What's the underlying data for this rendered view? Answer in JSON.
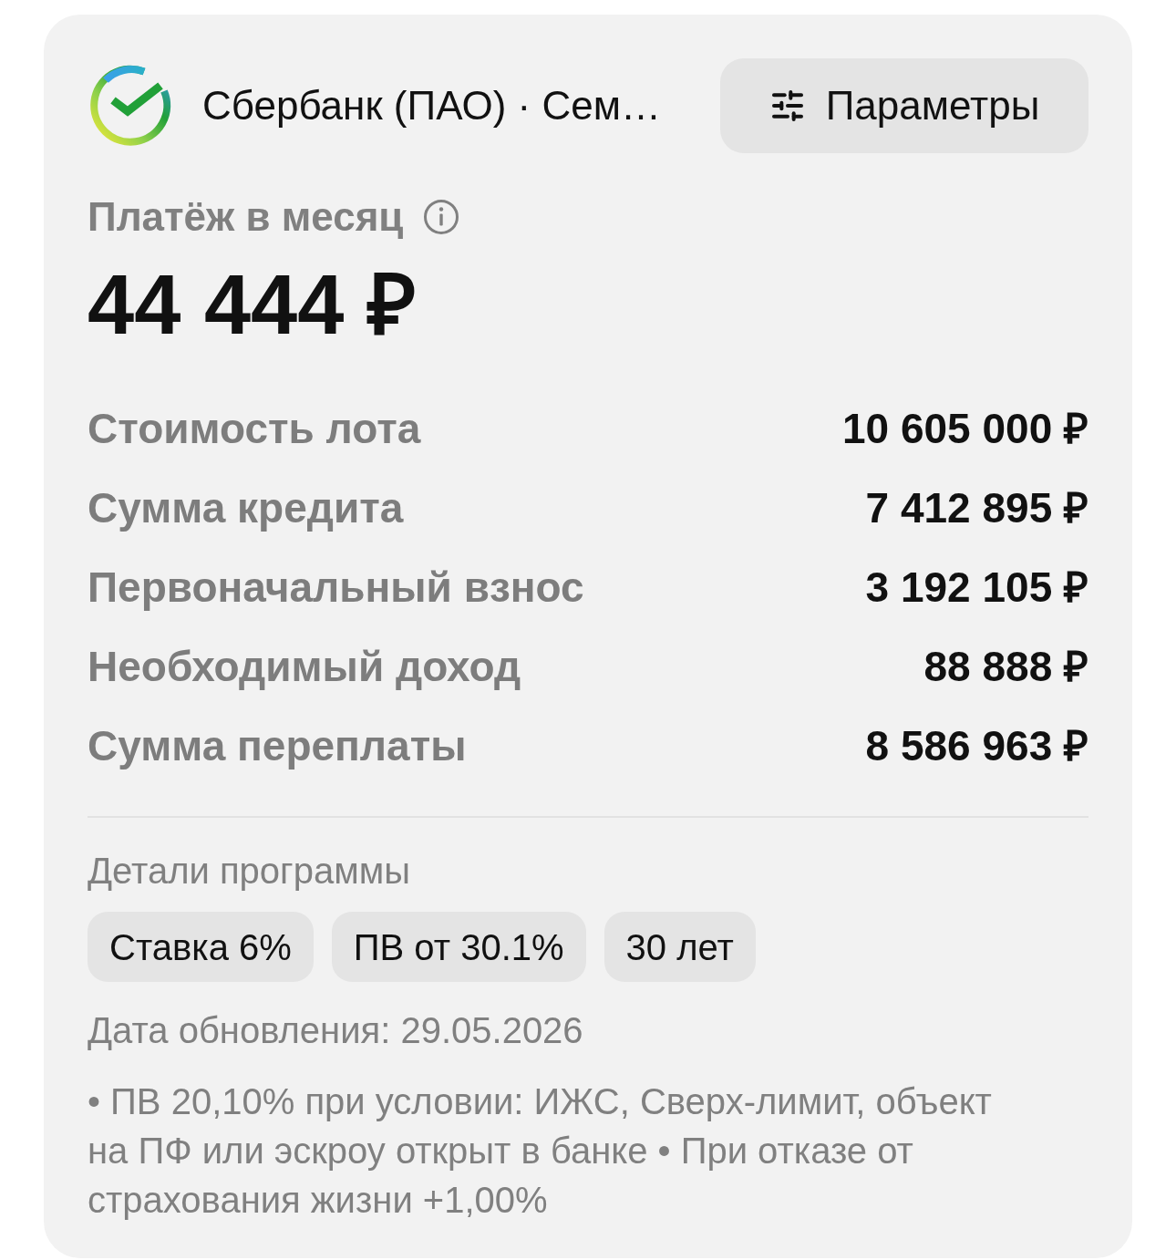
{
  "header": {
    "bank_title": "Сбербанк (ПАО) · Сем…",
    "params_button": "Параметры"
  },
  "payment": {
    "label": "Платёж в месяц",
    "amount": "44 444 ₽"
  },
  "summary_rows": [
    {
      "label": "Стоимость лота",
      "value": "10 605 000 ₽"
    },
    {
      "label": "Сумма кредита",
      "value": "7 412 895 ₽"
    },
    {
      "label": "Первоначальный взнос",
      "value": "3 192 105 ₽"
    },
    {
      "label": "Необходимый доход",
      "value": "88 888 ₽"
    },
    {
      "label": "Сумма переплаты",
      "value": "8 586 963 ₽"
    }
  ],
  "program": {
    "title": "Детали программы",
    "chips": [
      "Ставка 6%",
      "ПВ от 30.1%",
      "30 лет"
    ],
    "updated": "Дата обновления: 29.05.2026",
    "notes": "• ПВ 20,10% при условии: ИЖС, Сверх-лимит, объект на ПФ или эскроу открыт в банке • При отказе от страхования жизни +1,00%"
  }
}
